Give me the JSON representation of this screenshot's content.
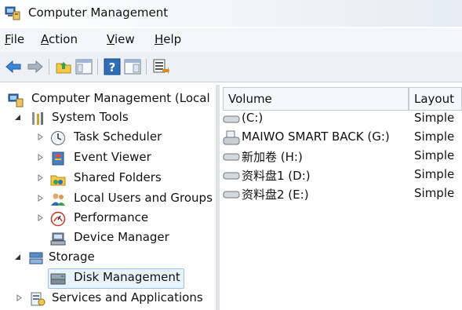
{
  "window": {
    "title": "Computer Management"
  },
  "menu": [
    "File",
    "Action",
    "View",
    "Help"
  ],
  "toolbar": [
    "back-arrow-icon",
    "forward-arrow-icon",
    "up-folder-icon",
    "show-hide-tree-icon",
    "help-icon",
    "properties-pane-icon",
    "export-list-icon"
  ],
  "tree": {
    "root": "Computer Management (Local",
    "system_tools": "System Tools",
    "task_scheduler": "Task Scheduler",
    "event_viewer": "Event Viewer",
    "shared_folders": "Shared Folders",
    "local_users": "Local Users and Groups",
    "performance": "Performance",
    "device_manager": "Device Manager",
    "storage": "Storage",
    "disk_management": "Disk Management",
    "services": "Services and Applications"
  },
  "list": {
    "columns": {
      "volume": "Volume",
      "layout": "Layout"
    },
    "rows": [
      {
        "volume": "(C:)",
        "layout": "Simple"
      },
      {
        "volume": "MAIWO SMART BACK (G:)",
        "layout": "Simple"
      },
      {
        "volume": "新加卷 (H:)",
        "layout": "Simple"
      },
      {
        "volume": "资料盘1 (D:)",
        "layout": "Simple"
      },
      {
        "volume": "资料盘2 (E:)",
        "layout": "Simple"
      }
    ]
  },
  "colors": {
    "selection": "#e9f3fc",
    "selection_border": "#99c5ec",
    "menubar": "#f3f5f8",
    "toolbar": "#edf1f6"
  }
}
